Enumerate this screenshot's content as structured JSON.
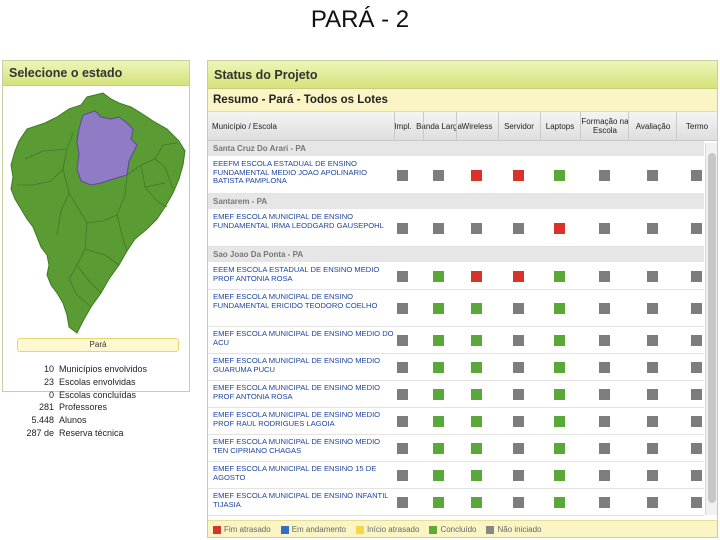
{
  "slide_title": "PARÁ - 2",
  "state_panel": {
    "title": "Selecione o estado",
    "selected_state": "Pará",
    "stats": [
      {
        "value": "10",
        "label": "Municípios envolvidos"
      },
      {
        "value": "23",
        "label": "Escolas envolvidas"
      },
      {
        "value": "0",
        "label": "Escolas concluídas"
      },
      {
        "value": "281",
        "label": "Professores"
      },
      {
        "value": "5.448",
        "label": "Alunos"
      },
      {
        "value": "287 de",
        "label": "Reserva técnica"
      }
    ]
  },
  "project_panel": {
    "title": "Status do Projeto",
    "subtitle": "Resumo - Pará - Todos os Lotes",
    "columns": [
      "Município / Escola",
      "Impl.",
      "Banda Larga",
      "Wireless",
      "Servidor",
      "Laptops",
      "Formação na Escola",
      "Avaliação",
      "Termo"
    ],
    "groups": [
      {
        "name": "Santa Cruz Do Arari - PA",
        "schools": [
          {
            "name": "EEEFM ESCOLA ESTADUAL DE ENSINO FUNDAMENTAL MEDIO JOAO APOLINARIO BATISTA PAMPLONA",
            "status": [
              "grey",
              "grey",
              "red",
              "red",
              "green",
              "grey",
              "grey",
              "grey"
            ]
          }
        ]
      },
      {
        "name": "Santarem - PA",
        "schools": [
          {
            "name": "EMEF ESCOLA MUNICIPAL DE ENSINO FUNDAMENTAL IRMA LEODGARD GAUSEPOHL",
            "status": [
              "grey",
              "grey",
              "grey",
              "grey",
              "red",
              "grey",
              "grey",
              "grey"
            ]
          }
        ]
      },
      {
        "name": "Sao Joao Da Ponta - PA",
        "schools": [
          {
            "name": "EEEM ESCOLA ESTADUAL DE ENSINO MEDIO PROF ANTONIA ROSA",
            "status": [
              "grey",
              "green",
              "red",
              "red",
              "green",
              "grey",
              "grey",
              "grey"
            ]
          },
          {
            "name": "EMEF ESCOLA MUNICIPAL DE ENSINO FUNDAMENTAL ERICIDO TEODORO COELHO",
            "status": [
              "grey",
              "green",
              "green",
              "grey",
              "green",
              "grey",
              "grey",
              "grey"
            ]
          },
          {
            "name": "EMEF ESCOLA MUNICIPAL DE ENSINO MEDIO DO ACU",
            "status": [
              "grey",
              "green",
              "green",
              "grey",
              "green",
              "grey",
              "grey",
              "grey"
            ]
          },
          {
            "name": "EMEF ESCOLA MUNICIPAL DE ENSINO MEDIO GUARUMA PUCU",
            "status": [
              "grey",
              "green",
              "green",
              "grey",
              "green",
              "grey",
              "grey",
              "grey"
            ]
          },
          {
            "name": "EMEF ESCOLA MUNICIPAL DE ENSINO MEDIO PROF ANTONIA ROSA",
            "status": [
              "grey",
              "green",
              "green",
              "grey",
              "green",
              "grey",
              "grey",
              "grey"
            ]
          },
          {
            "name": "EMEF ESCOLA MUNICIPAL DE ENSINO MEDIO PROF RAUL RODRIGUES LAGOIA",
            "status": [
              "grey",
              "green",
              "green",
              "grey",
              "green",
              "grey",
              "grey",
              "grey"
            ]
          },
          {
            "name": "EMEF ESCOLA MUNICIPAL DE ENSINO MEDIO TEN CIPRIANO CHAGAS",
            "status": [
              "grey",
              "green",
              "green",
              "grey",
              "green",
              "grey",
              "grey",
              "grey"
            ]
          },
          {
            "name": "EMEF ESCOLA MUNICIPAL DE ENSINO 15 DE AGOSTO",
            "status": [
              "grey",
              "green",
              "green",
              "grey",
              "green",
              "grey",
              "grey",
              "grey"
            ]
          },
          {
            "name": "EMEF ESCOLA MUNICIPAL DE ENSINO INFANTIL TIJASIA",
            "status": [
              "grey",
              "green",
              "green",
              "grey",
              "green",
              "grey",
              "grey",
              "grey"
            ]
          }
        ]
      }
    ],
    "legend": [
      {
        "label": "Fim atrasado",
        "color": "#d9342a"
      },
      {
        "label": "Em andamento",
        "color": "#2f6fc4"
      },
      {
        "label": "Início atrasado",
        "color": "#f2d84a"
      },
      {
        "label": "Concluído",
        "color": "#5faa3a"
      },
      {
        "label": "Não iniciado",
        "color": "#888888"
      }
    ],
    "status_colors": {
      "grey": "#7d7d7d",
      "green": "#5aa83a",
      "red": "#d7332a"
    }
  }
}
